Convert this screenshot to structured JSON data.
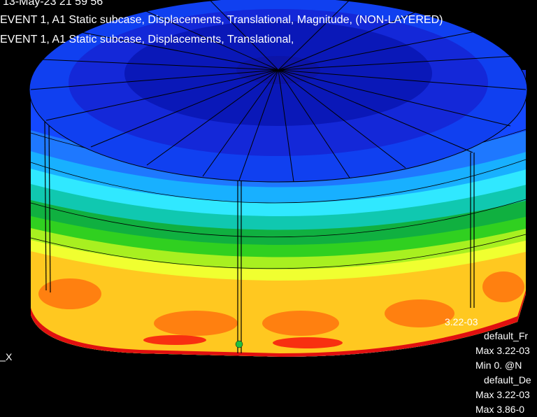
{
  "header": {
    "timestamp": "13-May-23 21 59 56",
    "line1": "EVENT 1, A1 Static subcase, Displacements, Translational, Magnitude, (NON-LAYERED)",
    "line2": "EVENT 1, A1 Static subcase, Displacements, Translational,"
  },
  "model": {
    "peak_label": "3.22-03",
    "triad_label": "X"
  },
  "legend": {
    "fringe_title": "default_Fr",
    "fringe_max": "Max 3.22-03",
    "fringe_min": "Min  0. @N",
    "deform_title": "default_De",
    "deform_max": "Max 3.22-03",
    "deform_max2": "Max 3.86-0"
  },
  "colors": {
    "background": "#000000",
    "contour": [
      "#1020e0",
      "#1448ff",
      "#1e78ff",
      "#18b0ff",
      "#30e8ff",
      "#10c8b0",
      "#10b040",
      "#30d020",
      "#a8f020",
      "#f0ff30",
      "#ffc820",
      "#ff8010",
      "#f83010",
      "#e01010"
    ]
  }
}
